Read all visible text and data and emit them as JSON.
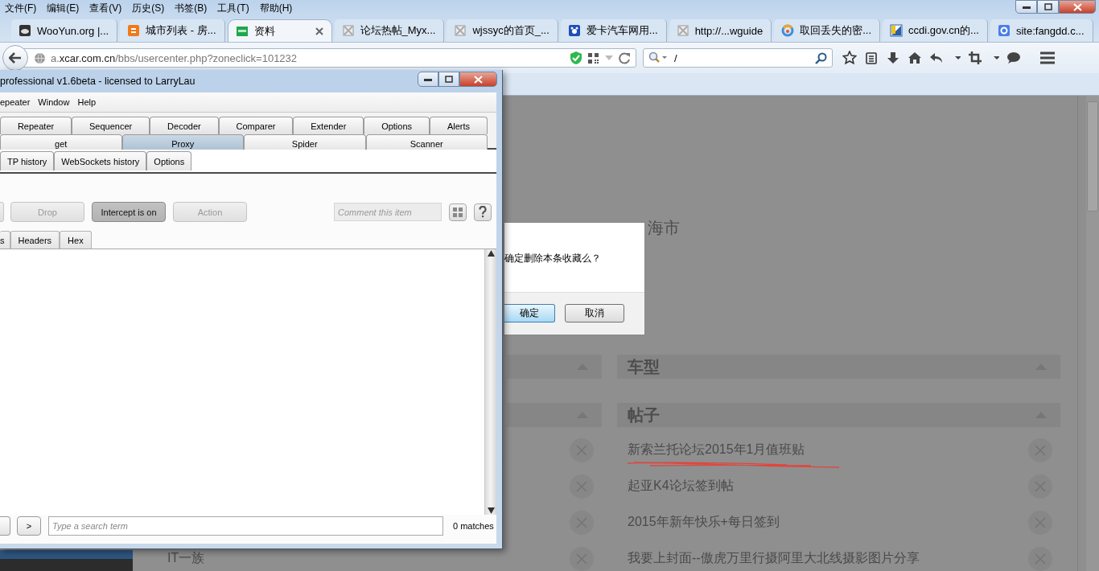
{
  "browser": {
    "menu": [
      "文件(F)",
      "编辑(E)",
      "查看(V)",
      "历史(S)",
      "书签(B)",
      "工具(T)",
      "帮助(H)"
    ],
    "tabs": [
      {
        "label": "WooYun.org |...",
        "selected": false
      },
      {
        "label": "城市列表 - 房...",
        "selected": false
      },
      {
        "label": "资料",
        "selected": true
      },
      {
        "label": "论坛热帖_Myx...",
        "selected": false
      },
      {
        "label": "wjssyc的首页_...",
        "selected": false
      },
      {
        "label": "爱卡汽车网用...",
        "selected": false
      },
      {
        "label": "http://...wguide",
        "selected": false
      },
      {
        "label": "取回丢失的密...",
        "selected": false
      },
      {
        "label": "ccdi.gov.cn的...",
        "selected": false
      },
      {
        "label": "site:fangdd.c...",
        "selected": false
      }
    ],
    "address": "a.**xcar.com.cn**/bbs/usercenter.php?zoneclick=101232",
    "search_value": "/"
  },
  "page": {
    "location_text": "海市",
    "columns": [
      {
        "sections": [
          {
            "expanded": true
          },
          {
            "expanded": true,
            "items": [
              {
                "removable": true
              },
              {
                "removable": true
              },
              {
                "removable": true
              },
              {
                "title": "IT一族",
                "removable": true
              }
            ]
          }
        ]
      },
      {
        "sections": [
          {
            "title": "车型",
            "expanded": true
          },
          {
            "title": "帖子",
            "expanded": true,
            "items": [
              {
                "title": "新索兰托论坛2015年1月值班贴",
                "underlined": true,
                "removable": true
              },
              {
                "title": "起亚K4论坛签到帖",
                "underlined": false,
                "removable": true
              },
              {
                "title": "2015年新年快乐+每日签到",
                "underlined": false,
                "removable": true
              },
              {
                "title": "我要上封面--傲虎万里行摄阿里大北线摄影图片分享",
                "underlined": false,
                "removable": true
              }
            ]
          }
        ]
      }
    ]
  },
  "dialog": {
    "message": "确定删除本条收藏么？",
    "buttons": [
      {
        "label": "确定",
        "default": true
      },
      {
        "label": "取消",
        "default": false
      }
    ]
  },
  "burp": {
    "title": "professional v1.6beta - licensed to LarryLau",
    "menu": [
      "epeater",
      "Window",
      "Help"
    ],
    "tool_tabs": [
      [
        {
          "label": "Repeater",
          "selected": false
        },
        {
          "label": "Sequencer",
          "selected": false
        },
        {
          "label": "Decoder",
          "selected": false
        },
        {
          "label": "Comparer",
          "selected": false
        },
        {
          "label": "Extender",
          "selected": false
        },
        {
          "label": "Options",
          "selected": false
        },
        {
          "label": "Alerts",
          "selected": false
        }
      ],
      [
        {
          "label": "get",
          "selected": false
        },
        {
          "label": "Proxy",
          "selected": true
        },
        {
          "label": "Spider",
          "selected": false
        },
        {
          "label": "Scanner",
          "selected": false
        }
      ]
    ],
    "proxy_tabs": [
      "TP history",
      "WebSockets history",
      "Options"
    ],
    "toolbar": [
      {
        "label": "Drop",
        "disabled": true,
        "pressed": false
      },
      {
        "label": "Intercept is on",
        "disabled": false,
        "pressed": true
      },
      {
        "label": "Action",
        "disabled": true,
        "pressed": false
      }
    ],
    "comment_placeholder": "Comment this item",
    "message_tabs": [
      "s",
      "Headers",
      "Hex"
    ],
    "next_button": ">",
    "search_placeholder": "Type a search term",
    "matches": "0 matches"
  }
}
